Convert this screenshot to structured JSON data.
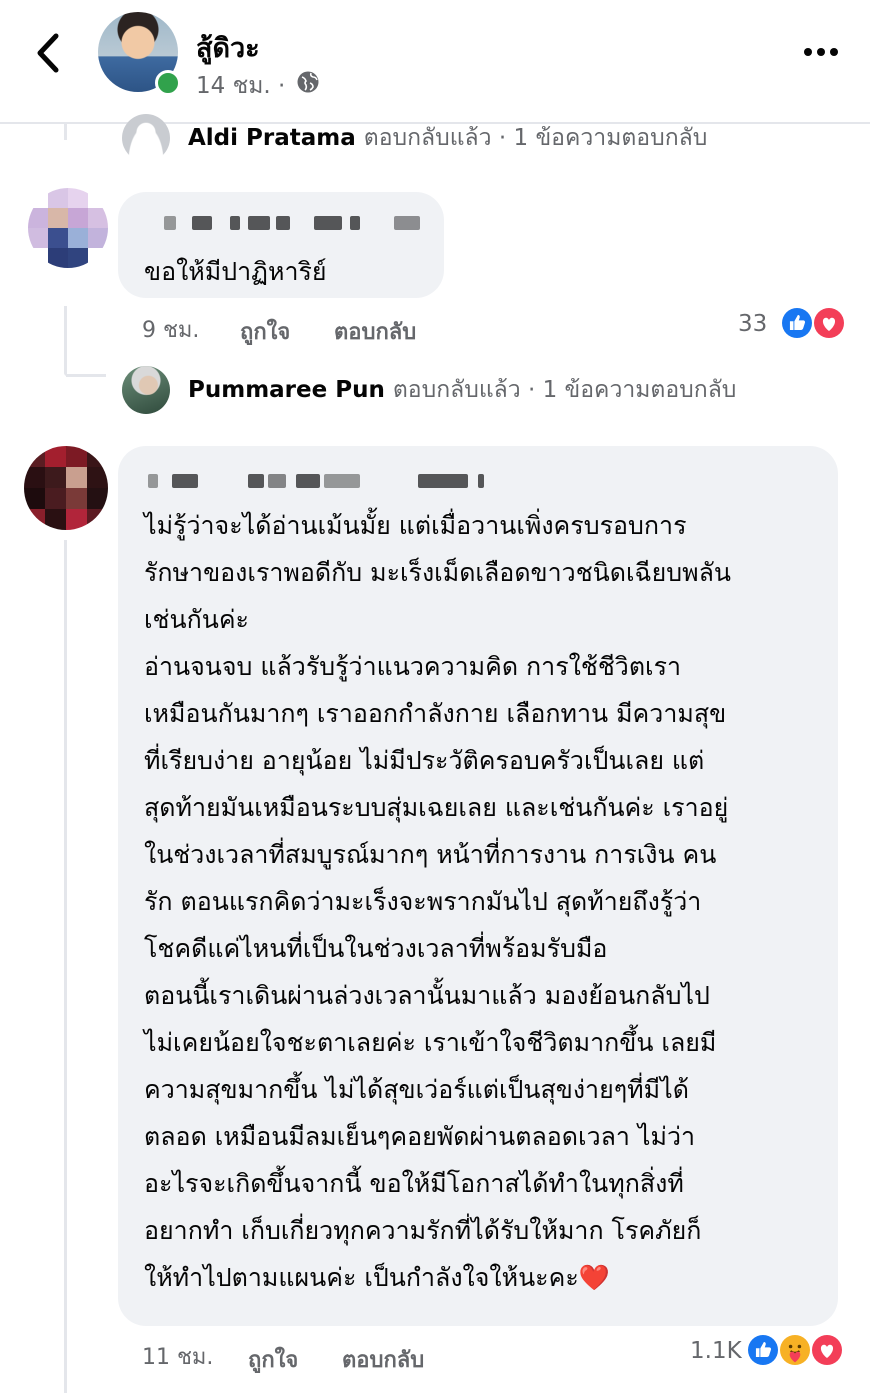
{
  "header": {
    "name": "สู้ดิวะ",
    "time": "14 ชม. ·",
    "icons": {
      "back": "chevron-left-icon",
      "privacy": "globe-icon",
      "more": "more-horizontal-icon"
    }
  },
  "reply_summary_1": {
    "name": "Aldi Pratama",
    "text": "ตอบกลับแล้ว · 1 ข้อความตอบกลับ"
  },
  "comment_1": {
    "text": "ขอให้มีปาฏิหาริย์",
    "time": "9 ชม.",
    "like_label": "ถูกใจ",
    "reply_label": "ตอบกลับ",
    "reaction_count": "33",
    "reactions": [
      "like-reaction-icon",
      "love-reaction-icon"
    ]
  },
  "reply_summary_2": {
    "name": "Pummaree Pun",
    "text": "ตอบกลับแล้ว · 1 ข้อความตอบกลับ"
  },
  "comment_2": {
    "lines": [
      "ไม่รู้ว่าจะได้อ่านเม้นมั้ย แต่เมื่อวานเพิ่งครบรอบการ",
      "รักษาของเราพอดีกับ มะเร็งเม็ดเลือดขาวชนิดเฉียบพลัน",
      "เช่นกันค่ะ",
      "อ่านจนจบ แล้วรับรู้ว่าแนวความคิด การใช้ชีวิตเรา",
      "เหมือนกันมากๆ เราออกกำลังกาย เลือกทาน มีความสุข",
      "ที่เรียบง่าย อายุน้อย ไม่มีประวัติครอบครัวเป็นเลย แต่",
      "สุดท้ายมันเหมือนระบบสุ่มเฉยเลย และเช่นกันค่ะ เราอยู่",
      "ในช่วงเวลาที่สมบูรณ์มากๆ หน้าที่การงาน การเงิน คน",
      "รัก ตอนแรกคิดว่ามะเร็งจะพรากมันไป สุดท้ายถึงรู้ว่า",
      "โชคดีแค่ไหนที่เป็นในช่วงเวลาที่พร้อมรับมือ",
      "ตอนนี้เราเดินผ่านล่วงเวลานั้นมาแล้ว มองย้อนกลับไป",
      "ไม่เคยน้อยใจชะตาเลยค่ะ เราเข้าใจชีวิตมากขึ้น เลยมี",
      "ความสุขมากขึ้น ไม่ได้สุขเว่อร์แต่เป็นสุขง่ายๆที่มีได้",
      "ตลอด เหมือนมีลมเย็นๆคอยพัดผ่านตลอดเวลา ไม่ว่า",
      "อะไรจะเกิดขึ้นจากนี้ ขอให้มีโอกาสได้ทำในทุกสิ่งที่",
      "อยากทำ เก็บเกี่ยวทุกความรักที่ได้รับให้มาก โรคภัยก็",
      "ให้ทำไปตามแผนค่ะ เป็นกำลังใจให้นะคะ❤️"
    ],
    "time": "11 ชม.",
    "like_label": "ถูกใจ",
    "reply_label": "ตอบกลับ",
    "reaction_count": "1.1K",
    "reactions": [
      "like-reaction-icon",
      "care-reaction-icon",
      "love-reaction-icon"
    ]
  },
  "colors": {
    "bubble": "#f0f2f5",
    "secondary_text": "#65676b",
    "like_blue": "#1877f2",
    "love_red": "#f33e58",
    "online_green": "#31a24c"
  }
}
